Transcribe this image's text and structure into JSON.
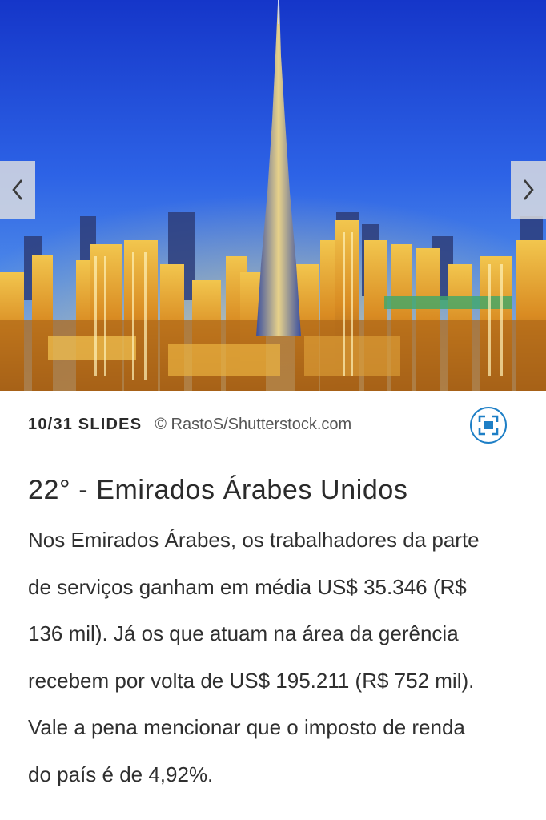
{
  "slideshow": {
    "image_alt": "Dubai skyline at dusk with Burj Khalifa",
    "prev_icon": "chevron-left-icon",
    "next_icon": "chevron-right-icon",
    "counter": "10/31 SLIDES",
    "credit": "© RastoS/Shutterstock.com",
    "fullscreen_icon": "fullscreen-icon",
    "accent_color": "#1e7fc6"
  },
  "slide": {
    "title": "22° - Emirados Árabes Unidos",
    "body": "Nos Emirados Árabes, os trabalhadores da parte\nde serviços ganham em média US$ 35.346 (R$\n136 mil). Já os que atuam na área da gerência\nrecebem por volta de  US$ 195.211 (R$ 752 mil).\nVale a pena mencionar que o imposto de renda\ndo país é de 4,92%."
  }
}
